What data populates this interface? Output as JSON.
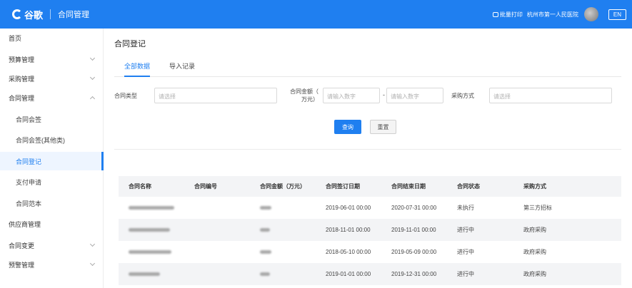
{
  "header": {
    "logo_text": "谷歌",
    "app_title": "合同管理",
    "print_label": "批量打印",
    "hospital": "杭州市第一人民医院",
    "lang": "EN"
  },
  "sidebar": {
    "items": [
      {
        "label": "首页"
      },
      {
        "label": "预算管理"
      },
      {
        "label": "采购管理"
      },
      {
        "label": "合同管理"
      },
      {
        "label": "合同会签"
      },
      {
        "label": "合同会签(其他类)"
      },
      {
        "label": "合同登记"
      },
      {
        "label": "支付申请"
      },
      {
        "label": "合同范本"
      },
      {
        "label": "供应商管理"
      },
      {
        "label": "合同变更"
      },
      {
        "label": "预警管理"
      }
    ]
  },
  "main": {
    "title": "合同登记",
    "tabs": [
      {
        "label": "全部数据"
      },
      {
        "label": "导入记录"
      }
    ],
    "filters": {
      "type_label": "合同类型",
      "type_placeholder": "请选择",
      "amount_label_1": "合同金额（",
      "amount_label_2": "万元）",
      "amount_min_placeholder": "请输入数字",
      "amount_sep": "-",
      "amount_max_placeholder": "请输入数字",
      "method_label": "采购方式",
      "method_placeholder": "请选择"
    },
    "buttons": {
      "query": "查询",
      "reset": "重置"
    }
  },
  "table": {
    "columns": [
      "合同名称",
      "合同编号",
      "合同金额（万元）",
      "合同签订日期",
      "合同结束日期",
      "合同状态",
      "采购方式"
    ],
    "rows": [
      {
        "sign_date": "2019-06-01 00:00",
        "end_date": "2020-07-31 00:00",
        "status": "未执行",
        "method": "第三方招标"
      },
      {
        "sign_date": "2018-11-01 00:00",
        "end_date": "2019-11-01 00:00",
        "status": "进行中",
        "method": "政府采购"
      },
      {
        "sign_date": "2018-05-10 00:00",
        "end_date": "2019-05-09 00:00",
        "status": "进行中",
        "method": "政府采购"
      },
      {
        "sign_date": "2019-01-01 00:00",
        "end_date": "2019-12-31 00:00",
        "status": "进行中",
        "method": "政府采购"
      }
    ]
  },
  "colors": {
    "primary": "#1f7ff0"
  }
}
